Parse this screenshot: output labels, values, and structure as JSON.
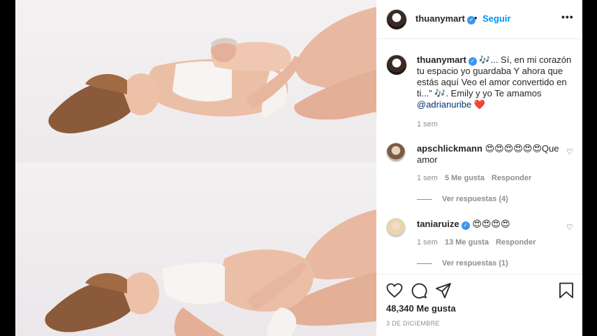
{
  "post": {
    "author": "thuanymart",
    "follow_label": "Seguir",
    "more_label": "•••",
    "separator": "•",
    "caption_text": "🎶... Sí, en mi corazón tu espacio yo guardaba Y ahora que estás aquí Veo el amor convertido en ti...” 🎶. Emily y yo Te amamos",
    "caption_mention": "@adrianuribe",
    "caption_emoji": "❤️",
    "caption_time": "1 sem"
  },
  "comments": [
    {
      "user": "apschlickmann",
      "verified": false,
      "text": "😍😍😍😍😍😍Que amor",
      "time": "1 sem",
      "likes": "5 Me gusta",
      "reply_label": "Responder",
      "view_replies": "Ver respuestas (4)"
    },
    {
      "user": "taniaruize",
      "verified": true,
      "text": "😍😍😍😍",
      "time": "1 sem",
      "likes": "13 Me gusta",
      "reply_label": "Responder",
      "view_replies": "Ver respuestas (1)"
    }
  ],
  "footer": {
    "likes": "48,340 Me gusta",
    "date": "3 DE DICIEMBRE"
  },
  "icons": {
    "verified": "✓",
    "comment_heart": "♡"
  }
}
